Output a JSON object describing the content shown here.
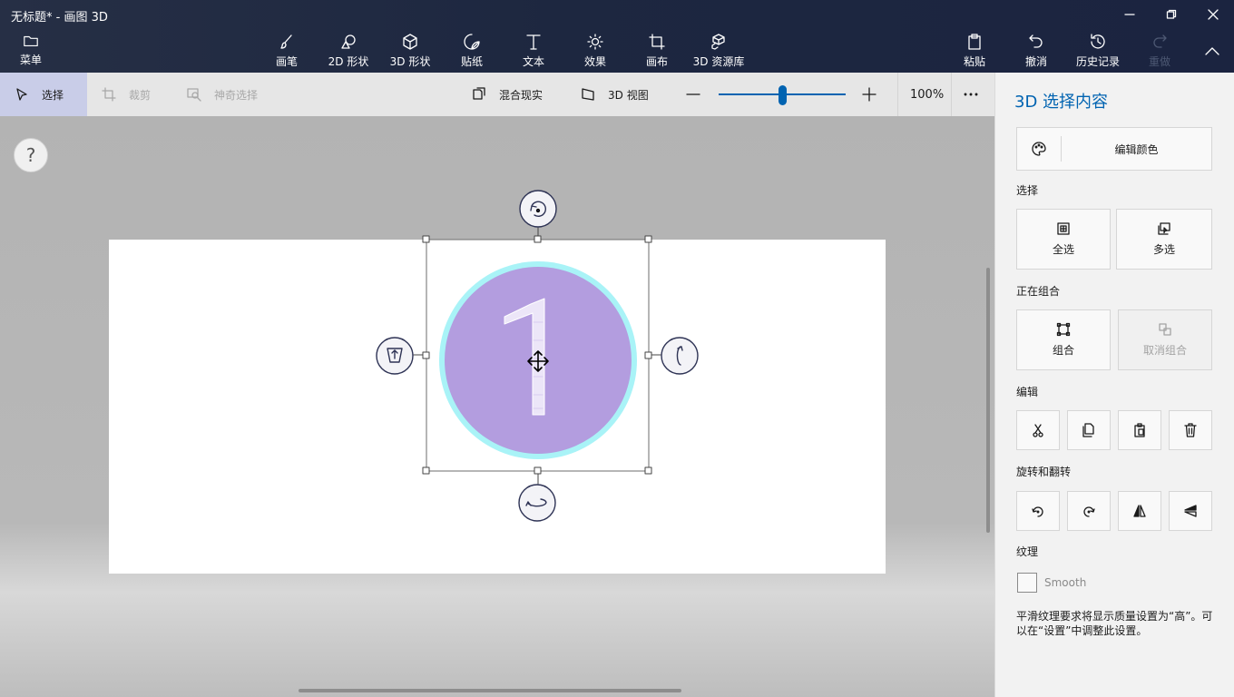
{
  "window": {
    "title": "无标题* - 画图 3D"
  },
  "ribbon": {
    "menu": "菜单",
    "tools": [
      "画笔",
      "2D 形状",
      "3D 形状",
      "贴纸",
      "文本",
      "效果",
      "画布",
      "3D 资源库"
    ],
    "paste": "粘贴",
    "undo": "撤消",
    "history": "历史记录",
    "redo": "重做"
  },
  "toolbar": {
    "select": "选择",
    "crop": "裁剪",
    "magic_select": "神奇选择",
    "mixed_reality": "混合现实",
    "view_3d": "3D 视图",
    "zoom": "100%",
    "zoom_level": 0.5
  },
  "canvas": {
    "object_glyph": "1",
    "circle_fill": "#b39ddf",
    "circle_outline": "#a9f3f7"
  },
  "help": {
    "label": "?"
  },
  "panel": {
    "title": "3D 选择内容",
    "edit_color": "编辑颜色",
    "select_heading": "选择",
    "select_all": "全选",
    "multi_select": "多选",
    "group_heading": "正在组合",
    "group": "组合",
    "ungroup": "取消组合",
    "edit_heading": "编辑",
    "rotate_heading": "旋转和翻转",
    "texture_heading": "纹理",
    "smooth": "Smooth",
    "note": "平滑纹理要求将显示质量设置为“高”。可以在“设置”中调整此设置。"
  },
  "colors": {
    "accent": "#0063b1",
    "title_bar": "#1f2940",
    "select_highlight": "#c9cde8"
  }
}
